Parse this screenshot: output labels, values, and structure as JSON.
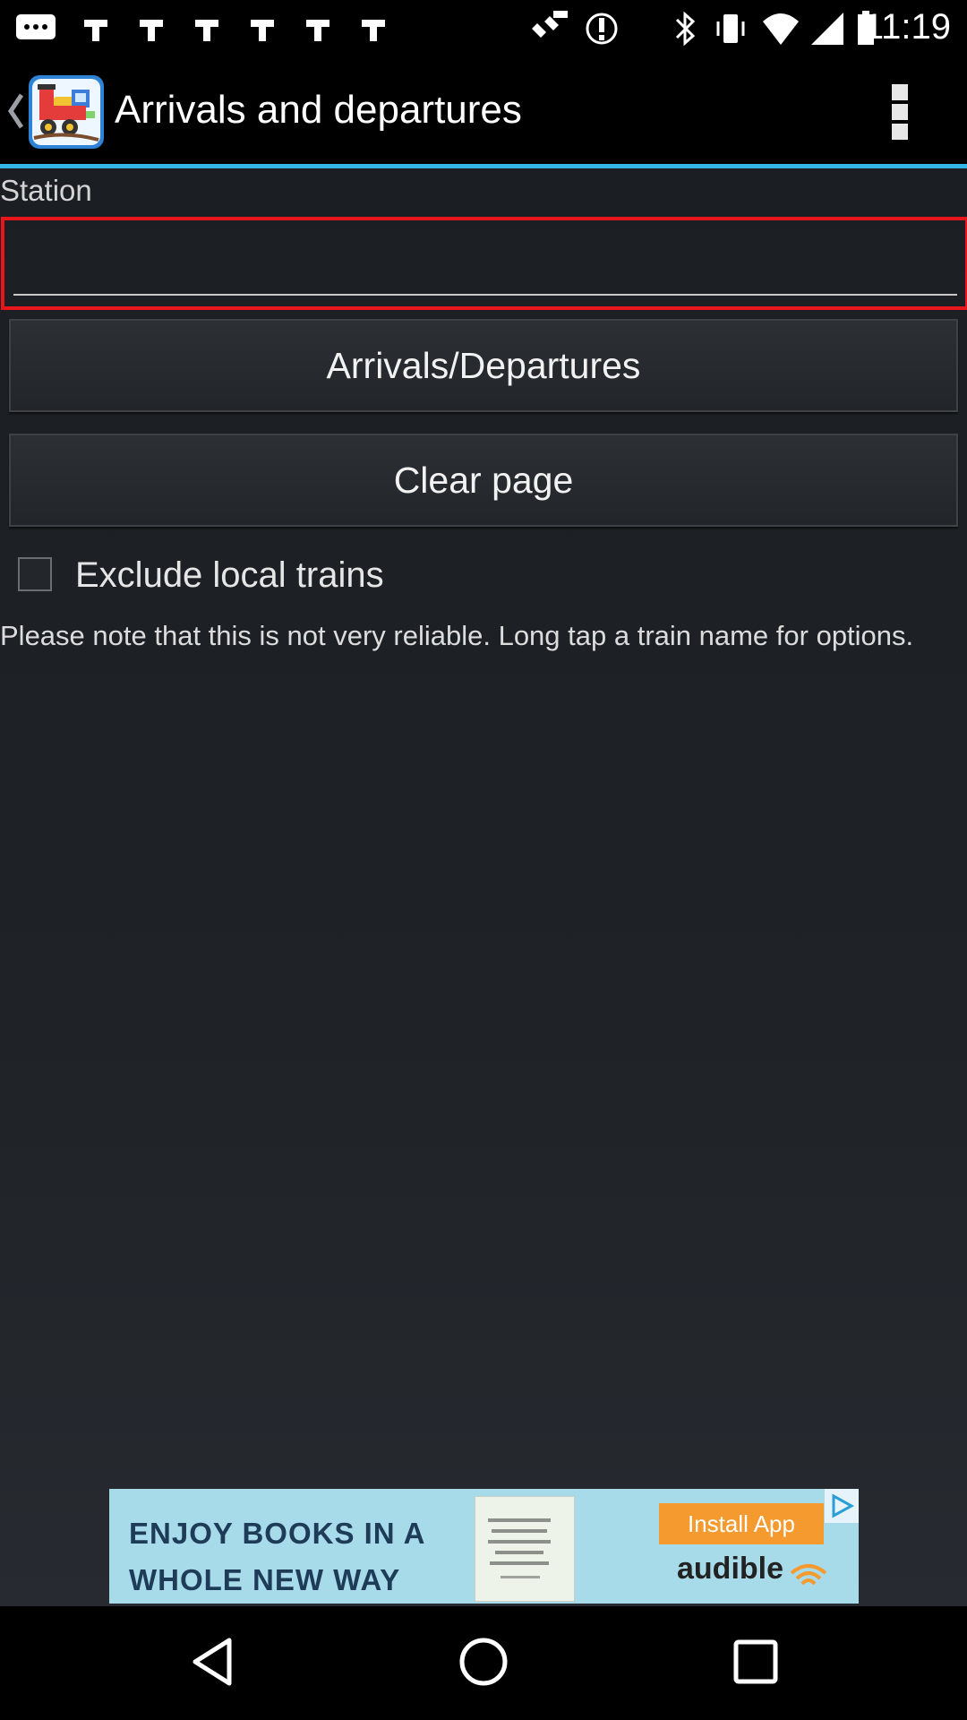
{
  "status_bar": {
    "time": "11:19",
    "icons": [
      "chat-icon",
      "notification-icon",
      "notification-icon",
      "notification-icon",
      "notification-icon",
      "fake-gps-icon",
      "satellite-icon",
      "info-icon",
      "bluetooth-icon",
      "vibrate-icon",
      "wifi-icon",
      "signal-icon",
      "battery-icon"
    ]
  },
  "action_bar": {
    "title": "Arrivals and departures"
  },
  "form": {
    "station_label": "Station",
    "station_value": "",
    "arrivals_departures_button": "Arrivals/Departures",
    "clear_page_button": "Clear page",
    "exclude_local_label": "Exclude local trains",
    "exclude_local_checked": false,
    "note": "Please note that this is not very reliable. Long tap a train name for options."
  },
  "ad": {
    "headline_line1": "ENJOY BOOKS IN A",
    "headline_line2": "WHOLE NEW WAY",
    "cta": "Install App",
    "brand": "audible"
  },
  "colors": {
    "accent": "#33b5e5",
    "focus_border": "#e8161b",
    "ad_background": "#a7dbe9",
    "ad_cta": "#f59a2e"
  }
}
